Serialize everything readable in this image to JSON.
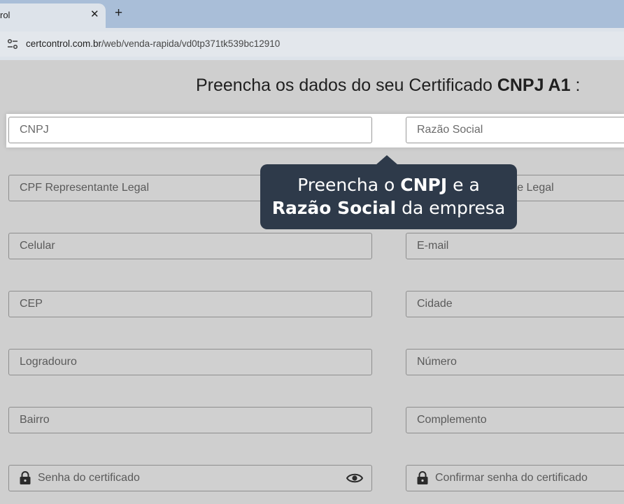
{
  "browser": {
    "tab_title": "rol",
    "tab_close": "✕",
    "new_tab": "+",
    "url_domain": "certcontrol.com.br",
    "url_path": "/web/venda-rapida/vd0tp371tk539bc12910"
  },
  "form": {
    "heading_prefix": "Preencha os dados do seu Certificado ",
    "heading_bold": "CNPJ A1",
    "heading_suffix": " :",
    "fields": {
      "cnpj": "CNPJ",
      "razao_social": "Razão Social",
      "cpf_representante": "CPF Representante Legal",
      "nome_representante": "Nome Representante Legal",
      "celular": "Celular",
      "email": "E-mail",
      "cep": "CEP",
      "cidade": "Cidade",
      "logradouro": "Logradouro",
      "numero": "Número",
      "bairro": "Bairro",
      "complemento": "Complemento",
      "senha": "Senha do certificado",
      "confirmar_senha": "Confirmar senha do certificado"
    }
  },
  "tooltip": {
    "line1_prefix": "Preencha o ",
    "line1_bold": "CNPJ",
    "line1_suffix": " e a",
    "line2_bold": "Razão Social",
    "line2_suffix": " da empresa"
  },
  "colors": {
    "tooltip_bg": "#2e3a4a",
    "page_bg": "#cfcfcf",
    "tabbar_bg": "#a9bed8"
  },
  "icons": [
    "close-icon",
    "plus-icon",
    "site-settings-icon",
    "lock-icon",
    "eye-icon"
  ]
}
